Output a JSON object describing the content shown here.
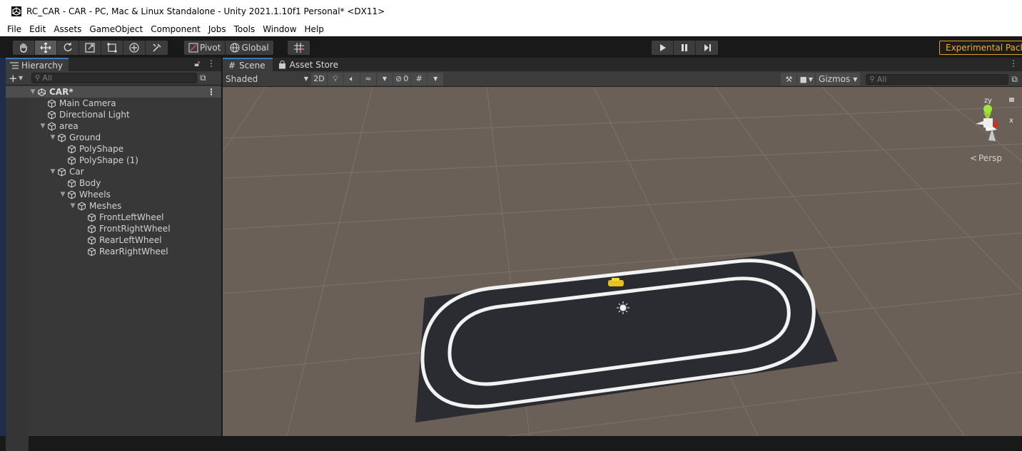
{
  "window": {
    "title": "RC_CAR - CAR - PC, Mac & Linux Standalone - Unity 2021.1.10f1 Personal* <DX11>"
  },
  "menu": [
    "File",
    "Edit",
    "Assets",
    "GameObject",
    "Component",
    "Jobs",
    "Tools",
    "Window",
    "Help"
  ],
  "toolbar": {
    "tools": [
      "hand-tool",
      "move-tool",
      "rotate-tool",
      "scale-tool",
      "rect-tool",
      "transform-tool",
      "custom-tool"
    ],
    "pivot_label": "Pivot",
    "global_label": "Global",
    "experimental_label": "Experimental Packa"
  },
  "hierarchy": {
    "tab_label": "Hierarchy",
    "search_placeholder": "All",
    "scene_name": "CAR*",
    "items": [
      {
        "label": "Main Camera",
        "depth": 1,
        "expand": false
      },
      {
        "label": "Directional Light",
        "depth": 1,
        "expand": false
      },
      {
        "label": "area",
        "depth": 1,
        "expand": true
      },
      {
        "label": "Ground",
        "depth": 2,
        "expand": true
      },
      {
        "label": "PolyShape",
        "depth": 3,
        "expand": false
      },
      {
        "label": "PolyShape (1)",
        "depth": 3,
        "expand": false
      },
      {
        "label": "Car",
        "depth": 2,
        "expand": true
      },
      {
        "label": "Body",
        "depth": 3,
        "expand": false
      },
      {
        "label": "Wheels",
        "depth": 3,
        "expand": true
      },
      {
        "label": "Meshes",
        "depth": 4,
        "expand": true
      },
      {
        "label": "FrontLeftWheel",
        "depth": 5,
        "expand": false
      },
      {
        "label": "FrontRightWheel",
        "depth": 5,
        "expand": false
      },
      {
        "label": "RearLeftWheel",
        "depth": 5,
        "expand": false
      },
      {
        "label": "RearRightWheel",
        "depth": 5,
        "expand": false
      }
    ]
  },
  "scene": {
    "tab_scene": "Scene",
    "tab_store": "Asset Store",
    "shading": "Shaded",
    "mode_2d": "2D",
    "hidden_count": "0",
    "gizmos_label": "Gizmos",
    "search_placeholder": "All",
    "projection": "Persp",
    "axis_y": "y",
    "axis_z": "z",
    "axis_x": "x"
  },
  "colors": {
    "accent": "#3a79bb",
    "ground": "#6b6058",
    "track": "#2a2c31",
    "experimental": "#f0b030"
  }
}
